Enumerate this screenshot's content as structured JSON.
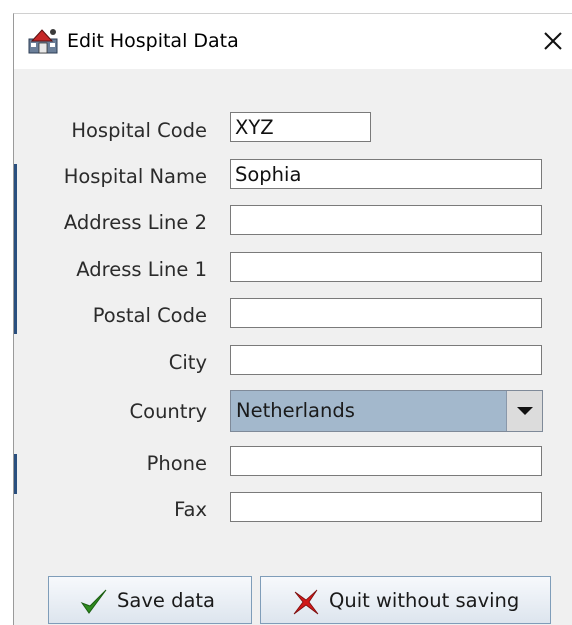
{
  "window": {
    "title": "Edit Hospital Data",
    "icon": "app-icon",
    "close_icon": "close-icon"
  },
  "form": {
    "fields": [
      {
        "label": "Hospital Code",
        "value": "XYZ",
        "placeholder": ""
      },
      {
        "label": "Hospital Name",
        "value": "Sophia",
        "placeholder": ""
      },
      {
        "label": "Address Line 2",
        "value": "",
        "placeholder": ""
      },
      {
        "label": "Adress Line 1",
        "value": "",
        "placeholder": ""
      },
      {
        "label": "Postal Code",
        "value": "",
        "placeholder": ""
      },
      {
        "label": "City",
        "value": "",
        "placeholder": ""
      },
      {
        "label": "Phone",
        "value": "",
        "placeholder": ""
      },
      {
        "label": "Fax",
        "value": "",
        "placeholder": ""
      }
    ],
    "country": {
      "label": "Country",
      "selected": "Netherlands",
      "arrow_icon": "chevron-down-icon"
    }
  },
  "buttons": {
    "save": {
      "label": "Save data",
      "icon": "checkmark-icon"
    },
    "quit": {
      "label": "Quit without saving",
      "icon": "x-cross-icon"
    }
  },
  "colors": {
    "window_bg": "#f0f0f0",
    "combo_selected_bg": "#a3b8cc",
    "check_green": "#2e8b1e",
    "cross_red": "#d11a1a"
  }
}
